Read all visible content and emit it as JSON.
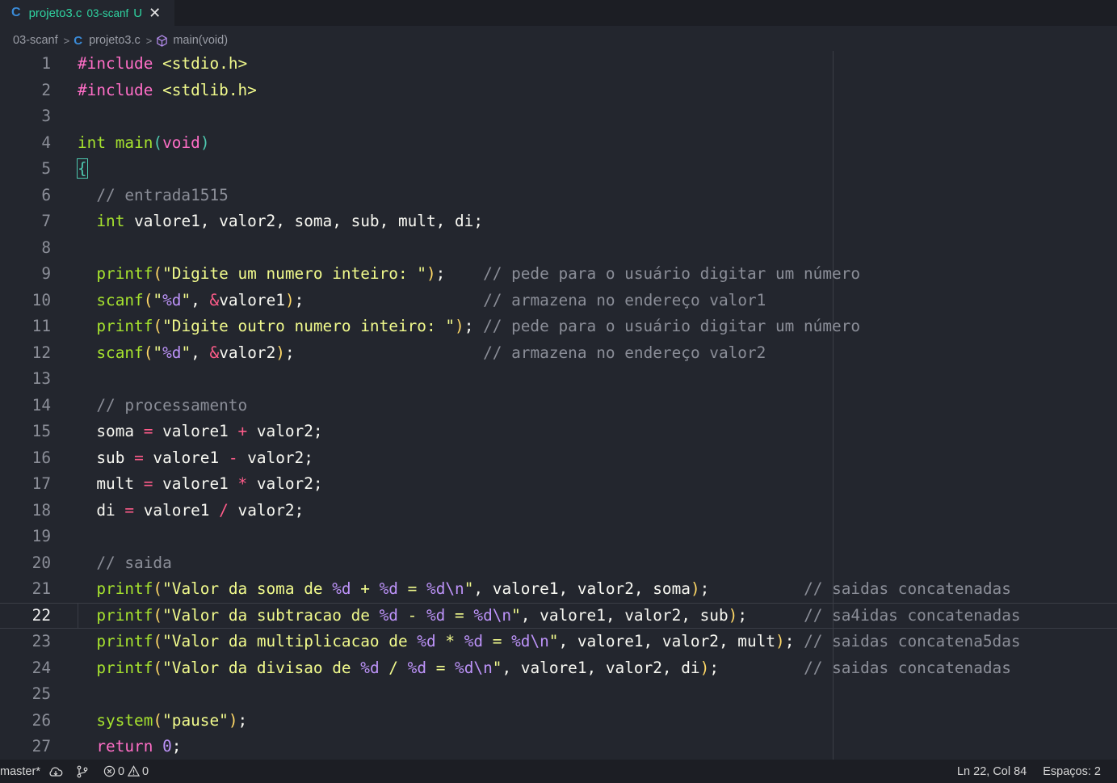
{
  "tab": {
    "file_name": "projeto3.c",
    "folder": "03-scanf",
    "status": "U",
    "close": "✕",
    "lang_icon": "C"
  },
  "breadcrumb": {
    "folder": "03-scanf",
    "file": "projeto3.c",
    "symbol": "main(void)",
    "lang_icon": "C"
  },
  "editor": {
    "current_line": 22,
    "lines": [
      {
        "n": "1",
        "html": "<span class='kw'>#include</span> <span class='str'>&lt;stdio.h&gt;</span>"
      },
      {
        "n": "2",
        "html": "<span class='kw'>#include</span> <span class='str'>&lt;stdlib.h&gt;</span>"
      },
      {
        "n": "3",
        "html": ""
      },
      {
        "n": "4",
        "html": "<span class='tyg'>int</span> <span class='fn'>main</span><span class='dimpar'>(</span><span class='kw'>void</span><span class='dimpar'>)</span>"
      },
      {
        "n": "5",
        "html": "<span class='brace-hl'>{</span>"
      },
      {
        "n": "6",
        "html": "  <span class='cm'>// entrada1515</span>"
      },
      {
        "n": "7",
        "html": "  <span class='tyg'>int</span> <span class='txt'>valore1, valor2, soma, sub, mult, di;</span>"
      },
      {
        "n": "8",
        "html": ""
      },
      {
        "n": "9",
        "html": "  <span class='fn'>printf</span><span class='par'>(</span><span class='str'>\"Digite um numero inteiro: \"</span><span class='par'>)</span><span class='txt'>;</span>    <span class='cm'>// pede para o usuário digitar um número</span>"
      },
      {
        "n": "10",
        "html": "  <span class='fn'>scanf</span><span class='par'>(</span><span class='str'>\"</span><span class='fmt'>%d</span><span class='str'>\"</span><span class='txt'>, </span><span class='op'>&amp;</span><span class='txt'>valore1</span><span class='par'>)</span><span class='txt'>;</span>                   <span class='cm'>// armazena no endereço valor1</span>"
      },
      {
        "n": "11",
        "html": "  <span class='fn'>printf</span><span class='par'>(</span><span class='str'>\"Digite outro numero inteiro: \"</span><span class='par'>)</span><span class='txt'>;</span> <span class='cm'>// pede para o usuário digitar um número</span>"
      },
      {
        "n": "12",
        "html": "  <span class='fn'>scanf</span><span class='par'>(</span><span class='str'>\"</span><span class='fmt'>%d</span><span class='str'>\"</span><span class='txt'>, </span><span class='op'>&amp;</span><span class='txt'>valor2</span><span class='par'>)</span><span class='txt'>;</span>                    <span class='cm'>// armazena no endereço valor2</span>"
      },
      {
        "n": "13",
        "html": ""
      },
      {
        "n": "14",
        "html": "  <span class='cm'>// processamento</span>"
      },
      {
        "n": "15",
        "html": "  <span class='txt'>soma </span><span class='op'>=</span><span class='txt'> valore1 </span><span class='op'>+</span><span class='txt'> valor2;</span>"
      },
      {
        "n": "16",
        "html": "  <span class='txt'>sub </span><span class='op'>=</span><span class='txt'> valore1 </span><span class='op'>-</span><span class='txt'> valor2;</span>"
      },
      {
        "n": "17",
        "html": "  <span class='txt'>mult </span><span class='op'>=</span><span class='txt'> valore1 </span><span class='op'>*</span><span class='txt'> valor2;</span>"
      },
      {
        "n": "18",
        "html": "  <span class='txt'>di </span><span class='op'>=</span><span class='txt'> valore1 </span><span class='op'>/</span><span class='txt'> valor2;</span>"
      },
      {
        "n": "19",
        "html": ""
      },
      {
        "n": "20",
        "html": "  <span class='cm'>// saida</span>"
      },
      {
        "n": "21",
        "html": "  <span class='fn'>printf</span><span class='par'>(</span><span class='str'>\"Valor da soma de </span><span class='fmt'>%d</span><span class='str'> + </span><span class='fmt'>%d</span><span class='str'> = </span><span class='fmt'>%d</span><span class='fmt'>\\n</span><span class='str'>\"</span><span class='txt'>, valore1, valor2, soma</span><span class='par'>)</span><span class='txt'>;</span>          <span class='cm'>// saidas concatenadas</span>"
      },
      {
        "n": "22",
        "html": "  <span class='fn'>printf</span><span class='par'>(</span><span class='str'>\"Valor da subtracao de </span><span class='fmt'>%d</span><span class='str'> - </span><span class='fmt'>%d</span><span class='str'> = </span><span class='fmt'>%d</span><span class='fmt'>\\n</span><span class='str'>\"</span><span class='txt'>, valore1, valor2, sub</span><span class='par'>)</span><span class='txt'>;</span>      <span class='cm'>// sa4idas concatenadas</span>"
      },
      {
        "n": "23",
        "html": "  <span class='fn'>printf</span><span class='par'>(</span><span class='str'>\"Valor da multiplicacao de </span><span class='fmt'>%d</span><span class='str'> * </span><span class='fmt'>%d</span><span class='str'> = </span><span class='fmt'>%d</span><span class='fmt'>\\n</span><span class='str'>\"</span><span class='txt'>, valore1, valor2, mult</span><span class='par'>)</span><span class='txt'>;</span> <span class='cm'>// saidas concatena5das</span>"
      },
      {
        "n": "24",
        "html": "  <span class='fn'>printf</span><span class='par'>(</span><span class='str'>\"Valor da divisao de </span><span class='fmt'>%d</span><span class='str'> / </span><span class='fmt'>%d</span><span class='str'> = </span><span class='fmt'>%d</span><span class='fmt'>\\n</span><span class='str'>\"</span><span class='txt'>, valore1, valor2, di</span><span class='par'>)</span><span class='txt'>;</span>         <span class='cm'>// saidas concatenadas</span>"
      },
      {
        "n": "25",
        "html": ""
      },
      {
        "n": "26",
        "html": "  <span class='fn'>system</span><span class='par'>(</span><span class='str'>\"pause\"</span><span class='par'>)</span><span class='txt'>;</span>"
      },
      {
        "n": "27",
        "html": "  <span class='kw'>return</span> <span class='num'>0</span><span class='txt'>;</span>"
      }
    ]
  },
  "statusbar": {
    "branch": "master*",
    "errors": "0",
    "warnings": "0",
    "position": "Ln 22, Col 84",
    "indent": "Espaços: 2"
  }
}
